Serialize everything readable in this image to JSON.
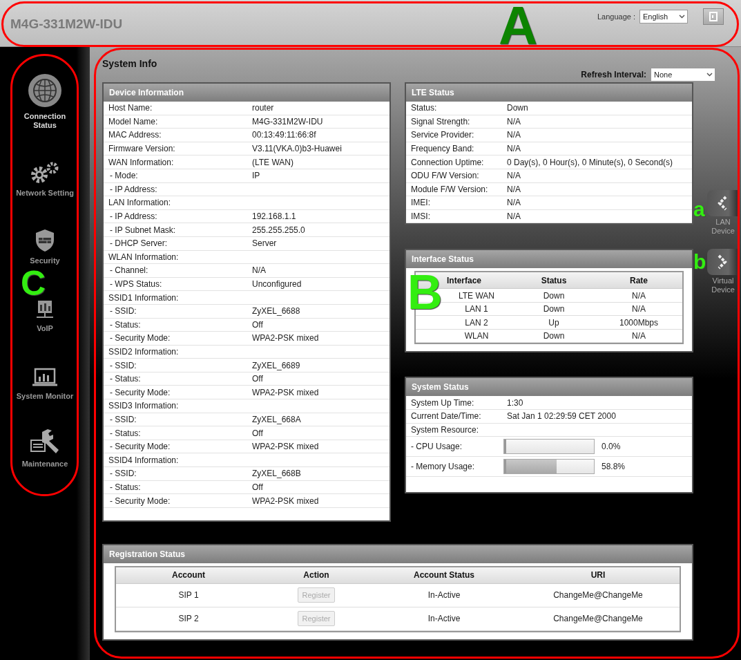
{
  "header": {
    "title": "M4G-331M2W-IDU",
    "language_label": "Language :",
    "language_value": "English"
  },
  "sidebar": {
    "items": [
      {
        "label": "Connection Status",
        "selected": true
      },
      {
        "label": "Network Setting",
        "selected": false
      },
      {
        "label": "Security",
        "selected": false
      },
      {
        "label": "VoIP",
        "selected": false
      },
      {
        "label": "System Monitor",
        "selected": false
      },
      {
        "label": "Maintenance",
        "selected": false
      }
    ]
  },
  "page_title": "System Info",
  "refresh": {
    "label": "Refresh Interval:",
    "value": "None"
  },
  "device_information": {
    "title": "Device Information",
    "rows": [
      {
        "kind": "item",
        "label": "Host Name:",
        "value": "router"
      },
      {
        "kind": "item",
        "label": "Model Name:",
        "value": "M4G-331M2W-IDU"
      },
      {
        "kind": "item",
        "label": "MAC Address:",
        "value": "00:13:49:11:66:8f"
      },
      {
        "kind": "item",
        "label": "Firmware Version:",
        "value": "V3.11(VKA.0)b3-Huawei"
      },
      {
        "kind": "item",
        "label": "WAN Information:",
        "value": " (LTE WAN)"
      },
      {
        "kind": "sub",
        "label": "- Mode:",
        "value": "IP"
      },
      {
        "kind": "sub",
        "label": "- IP Address:"
      },
      {
        "kind": "item",
        "label": "LAN Information:"
      },
      {
        "kind": "sub",
        "label": "- IP Address:",
        "value": "192.168.1.1"
      },
      {
        "kind": "sub",
        "label": "- IP Subnet Mask:",
        "value": "255.255.255.0"
      },
      {
        "kind": "sub",
        "label": "- DHCP Server:",
        "value": "Server"
      },
      {
        "kind": "item",
        "label": "WLAN Information:"
      },
      {
        "kind": "sub",
        "label": "- Channel:",
        "value": "N/A"
      },
      {
        "kind": "sub",
        "label": "- WPS Status:",
        "value": "Unconfigured"
      },
      {
        "kind": "item",
        "label": "SSID1 Information:"
      },
      {
        "kind": "sub",
        "label": "- SSID:",
        "value": "ZyXEL_6688"
      },
      {
        "kind": "sub",
        "label": "- Status:",
        "value": "Off"
      },
      {
        "kind": "sub",
        "label": "- Security Mode:",
        "value": "WPA2-PSK mixed"
      },
      {
        "kind": "item",
        "label": "SSID2 Information:"
      },
      {
        "kind": "sub",
        "label": "- SSID:",
        "value": "ZyXEL_6689"
      },
      {
        "kind": "sub",
        "label": "- Status:",
        "value": "Off"
      },
      {
        "kind": "sub",
        "label": "- Security Mode:",
        "value": "WPA2-PSK mixed"
      },
      {
        "kind": "item",
        "label": "SSID3 Information:"
      },
      {
        "kind": "sub",
        "label": "- SSID:",
        "value": "ZyXEL_668A"
      },
      {
        "kind": "sub",
        "label": "- Status:",
        "value": "Off"
      },
      {
        "kind": "sub",
        "label": "- Security Mode:",
        "value": "WPA2-PSK mixed"
      },
      {
        "kind": "item",
        "label": "SSID4 Information:"
      },
      {
        "kind": "sub",
        "label": "- SSID:",
        "value": "ZyXEL_668B"
      },
      {
        "kind": "sub",
        "label": "- Status:",
        "value": "Off"
      },
      {
        "kind": "sub",
        "label": "- Security Mode:",
        "value": "WPA2-PSK mixed"
      }
    ]
  },
  "lte_status": {
    "title": "LTE Status",
    "rows": [
      {
        "label": "Status:",
        "value": "Down"
      },
      {
        "label": "Signal Strength:",
        "value": "N/A"
      },
      {
        "label": "Service Provider:",
        "value": "N/A"
      },
      {
        "label": "Frequency Band:",
        "value": "N/A"
      },
      {
        "label": "Connection Uptime:",
        "value": "0 Day(s), 0 Hour(s), 0 Minute(s), 0 Second(s)"
      },
      {
        "label": "ODU F/W Version:",
        "value": "N/A"
      },
      {
        "label": "Module F/W Version:",
        "value": "N/A"
      },
      {
        "label": "IMEI:",
        "value": "N/A"
      },
      {
        "label": "IMSI:",
        "value": "N/A"
      }
    ]
  },
  "interface_status": {
    "title": "Interface Status",
    "columns": [
      "Interface",
      "Status",
      "Rate"
    ],
    "rows": [
      [
        "LTE WAN",
        "Down",
        "N/A"
      ],
      [
        "LAN 1",
        "Down",
        "N/A"
      ],
      [
        "LAN 2",
        "Up",
        "1000Mbps"
      ],
      [
        "WLAN",
        "Down",
        "N/A"
      ]
    ]
  },
  "system_status": {
    "title": "System Status",
    "rows": [
      {
        "kind": "text",
        "label": "System Up Time:",
        "value": "1:30"
      },
      {
        "kind": "text",
        "label": "Current Date/Time:",
        "value": "Sat Jan 1 02:29:59 CET 2000"
      },
      {
        "kind": "text",
        "label": "System Resource:"
      },
      {
        "kind": "meter",
        "label": "- CPU Usage:",
        "level": 0,
        "reading": "0.0%"
      },
      {
        "kind": "meter",
        "label": "- Memory Usage:",
        "level": 0.588,
        "reading": "58.8%"
      }
    ]
  },
  "side_tabs": [
    {
      "label": "LAN Device"
    },
    {
      "label": "Virtual Device"
    }
  ],
  "registration_status": {
    "title": "Registration Status",
    "columns": [
      "Account",
      "Action",
      "Account Status",
      "URI"
    ],
    "rows": [
      {
        "account": "SIP 1",
        "action": "Register",
        "disabled": true,
        "status": "In-Active",
        "uri": "ChangeMe@ChangeMe"
      },
      {
        "account": "SIP 2",
        "action": "Register",
        "disabled": true,
        "status": "In-Active",
        "uri": "ChangeMe@ChangeMe"
      }
    ]
  },
  "annotations": [
    {
      "label": "A"
    },
    {
      "label": "a"
    },
    {
      "label": "C"
    },
    {
      "label": "B"
    },
    {
      "label": "b"
    }
  ]
}
